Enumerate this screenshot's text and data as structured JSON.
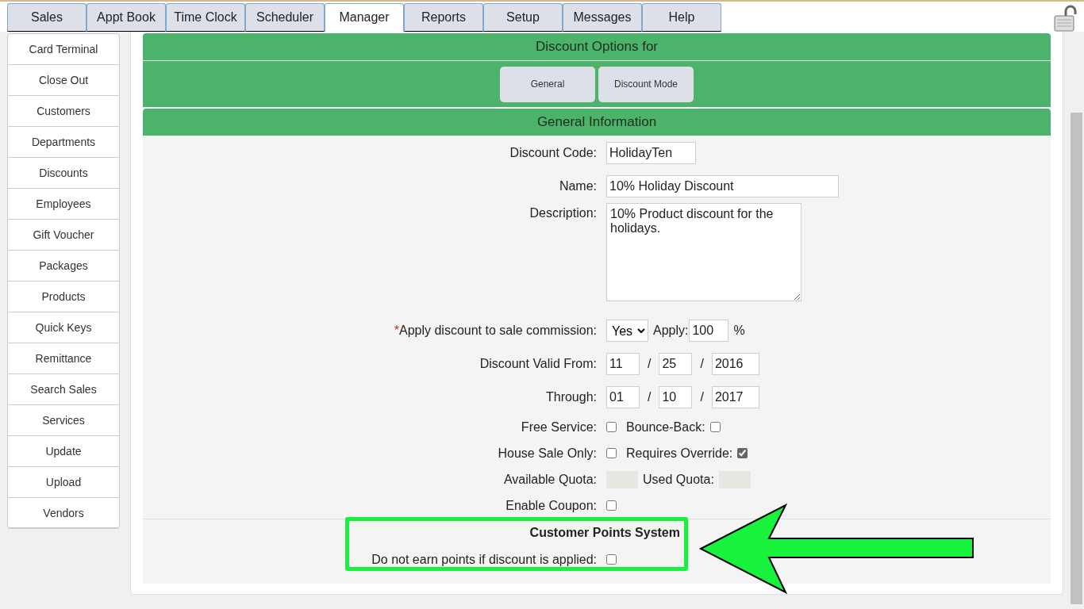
{
  "tabs": [
    {
      "label": "Sales",
      "selected": false
    },
    {
      "label": "Appt Book",
      "selected": false
    },
    {
      "label": "Time Clock",
      "selected": false
    },
    {
      "label": "Scheduler",
      "selected": false
    },
    {
      "label": "Manager",
      "selected": true
    },
    {
      "label": "Reports",
      "selected": false
    },
    {
      "label": "Setup",
      "selected": false
    },
    {
      "label": "Messages",
      "selected": false
    },
    {
      "label": "Help",
      "selected": false
    }
  ],
  "sidebar": {
    "items": [
      "Card Terminal",
      "Close Out",
      "Customers",
      "Departments",
      "Discounts",
      "Employees",
      "Gift Voucher",
      "Packages",
      "Products",
      "Quick Keys",
      "Remittance",
      "Search Sales",
      "Services",
      "Update",
      "Upload",
      "Vendors"
    ]
  },
  "panel": {
    "title": "Discount Options for",
    "buttons": [
      "General",
      "Discount Mode"
    ],
    "section_title": "General Information",
    "fields": [
      {
        "kind": "short",
        "label": "Discount Code:",
        "value": "HolidayTen"
      },
      {
        "kind": "long",
        "label": "Name:",
        "value": "10% Holiday Discount"
      },
      {
        "kind": "textarea",
        "label": "Description:",
        "value": "10% Product discount for the holidays."
      },
      {
        "kind": "commission",
        "required_mark": "*",
        "label": "Apply discount to sale commission:",
        "value": "Yes",
        "apply_label": "Apply:",
        "apply_value": "100",
        "unit": "%"
      },
      {
        "kind": "date",
        "label": "Discount Valid From:",
        "parts": [
          "11",
          "25",
          "2016"
        ],
        "separator": "/"
      },
      {
        "kind": "date",
        "label": "Through:",
        "parts": [
          "01",
          "10",
          "2017"
        ],
        "separator": "/"
      },
      {
        "kind": "checks",
        "label": "Free Service:",
        "checked": false,
        "extra_label": "Bounce-Back:",
        "extra_checked": false
      },
      {
        "kind": "checks",
        "label": "House Sale Only:",
        "checked": false,
        "extra_label": "Requires Override:",
        "extra_checked": true
      },
      {
        "kind": "quota",
        "label": "Available Quota:",
        "extra_label": "Used Quota:"
      },
      {
        "kind": "check",
        "label": "Enable Coupon:",
        "checked": false
      }
    ],
    "points": {
      "title": "Customer Points System",
      "label": "Do not earn points if discount is applied:",
      "checked": false
    }
  }
}
